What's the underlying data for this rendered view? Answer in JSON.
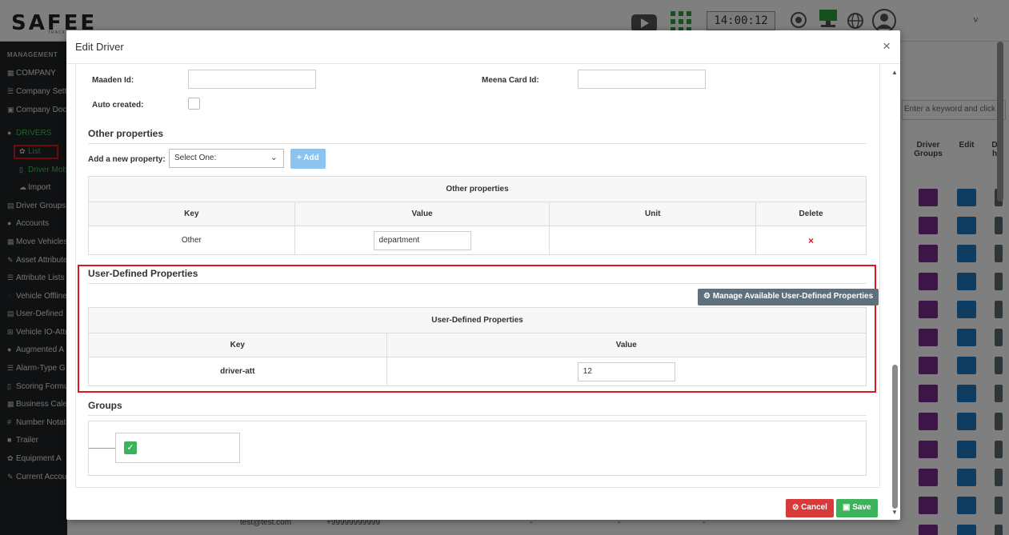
{
  "app": {
    "logo_text": "SAFEE",
    "logo_sub": "TRACK",
    "clock": "14:00:12",
    "user_menu_chevron": "˅"
  },
  "sidebar": {
    "heading": "MANAGEMENT",
    "items": [
      {
        "label": "COMPANY",
        "icon": "building-icon"
      },
      {
        "label": "Company Settings",
        "icon": "list-icon"
      },
      {
        "label": "Company Documents",
        "icon": "image-icon"
      },
      {
        "label": "DRIVERS",
        "icon": "users-icon"
      },
      {
        "label": "List",
        "icon": "gear-icon"
      },
      {
        "label": "Driver Mobile",
        "icon": "mobile-icon"
      },
      {
        "label": "Import",
        "icon": "cloud-upload-icon"
      },
      {
        "label": "Driver Groups",
        "icon": "group-icon"
      },
      {
        "label": "Accounts",
        "icon": "accounts-icon"
      },
      {
        "label": "Move Vehicles",
        "icon": "move-icon"
      },
      {
        "label": "Asset Attributes",
        "icon": "edit-icon"
      },
      {
        "label": "Attribute Lists",
        "icon": "list-icon"
      },
      {
        "label": "Vehicle Offline",
        "icon": "eye-slash-icon"
      },
      {
        "label": "User-Defined",
        "icon": "list-alt-icon"
      },
      {
        "label": "Vehicle IO-Attr",
        "icon": "grid-icon"
      },
      {
        "label": "Augmented A",
        "icon": "circle-icon"
      },
      {
        "label": "Alarm-Type G",
        "icon": "list-icon"
      },
      {
        "label": "Scoring Formula",
        "icon": "file-icon"
      },
      {
        "label": "Business Calendar",
        "icon": "calendar-icon"
      },
      {
        "label": "Number Notation",
        "icon": "hash-icon"
      },
      {
        "label": "Trailer",
        "icon": "square-icon"
      },
      {
        "label": "Equipment A",
        "icon": "cogs-icon"
      },
      {
        "label": "Current Account",
        "icon": "wrench-icon"
      }
    ]
  },
  "background": {
    "search_placeholder": "Enter a keyword and click '",
    "col_driver_groups": "Driver Groups",
    "col_edit": "Edit",
    "col_partial": "D h",
    "row_email": "test@test.com",
    "row_phone": "+99999999999",
    "dash": "-"
  },
  "modal": {
    "title": "Edit Driver",
    "close": "×",
    "maaden_label": "Maaden Id:",
    "maaden_value": "",
    "meena_label": "Meena Card Id:",
    "meena_value": "",
    "auto_created_label": "Auto created:",
    "other_properties": {
      "title": "Other properties",
      "add_label": "Add a new property:",
      "select_value": "Select One:",
      "add_button": "Add",
      "table_caption": "Other properties",
      "columns": [
        "Key",
        "Value",
        "Unit",
        "Delete"
      ],
      "rows": [
        {
          "key": "Other",
          "value": "department",
          "unit": "",
          "delete": "×"
        }
      ]
    },
    "user_defined": {
      "title": "User-Defined Properties",
      "manage_button": "Manage Available User-Defined Properties",
      "table_caption": "User-Defined Properties",
      "columns": [
        "Key",
        "Value"
      ],
      "rows": [
        {
          "key": "driver-att",
          "value": "12"
        }
      ]
    },
    "groups": {
      "title": "Groups"
    },
    "buttons": {
      "cancel": "Cancel",
      "save": "Save"
    }
  }
}
